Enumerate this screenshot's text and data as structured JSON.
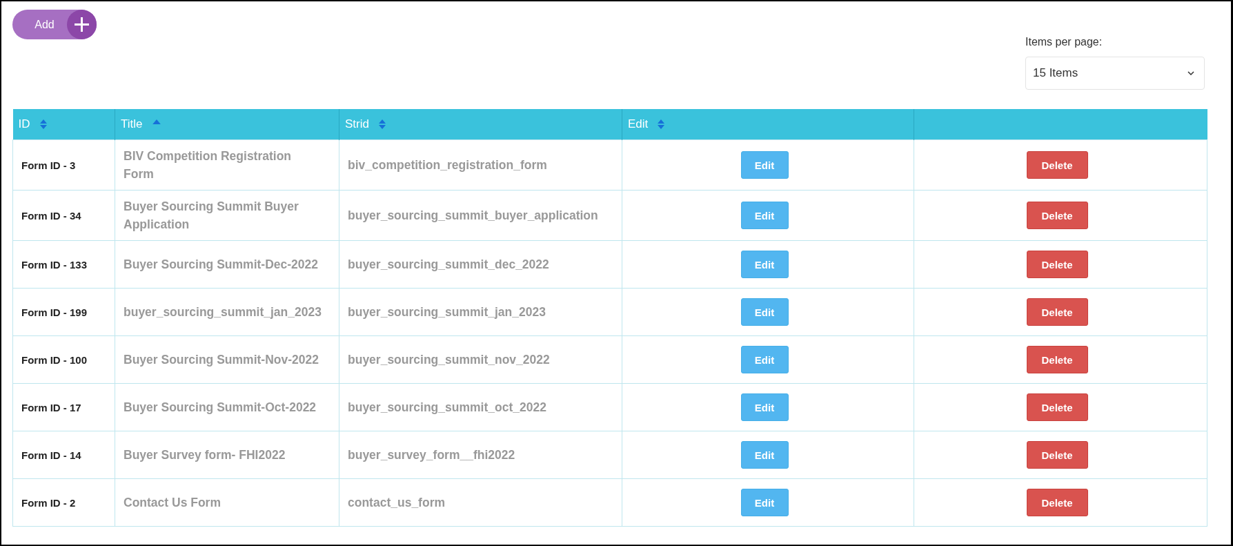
{
  "add_button": {
    "label": "Add"
  },
  "pagination": {
    "label": "Items per page:",
    "value": "15 Items"
  },
  "table": {
    "columns": [
      {
        "label": "ID",
        "sortable": true,
        "sorted": false
      },
      {
        "label": "Title",
        "sortable": true,
        "sorted": true
      },
      {
        "label": "Strid",
        "sortable": true,
        "sorted": false
      },
      {
        "label": "Edit",
        "sortable": true,
        "sorted": false
      },
      {
        "sortable": false
      }
    ],
    "rows": [
      {
        "id": "Form ID - 3",
        "title": "BIV Competition Registration Form",
        "strid": "biv_competition_registration_form",
        "edit": "Edit",
        "delete": "Delete"
      },
      {
        "id": "Form ID - 34",
        "title": "Buyer Sourcing Summit Buyer Application",
        "strid": "buyer_sourcing_summit_buyer_application",
        "edit": "Edit",
        "delete": "Delete"
      },
      {
        "id": "Form ID - 133",
        "title": "Buyer Sourcing Summit-Dec-2022",
        "strid": "buyer_sourcing_summit_dec_2022",
        "edit": "Edit",
        "delete": "Delete"
      },
      {
        "id": "Form ID - 199",
        "title": "buyer_sourcing_summit_jan_2023",
        "strid": "buyer_sourcing_summit_jan_2023",
        "edit": "Edit",
        "delete": "Delete"
      },
      {
        "id": "Form ID - 100",
        "title": "Buyer Sourcing Summit-Nov-2022",
        "strid": "buyer_sourcing_summit_nov_2022",
        "edit": "Edit",
        "delete": "Delete"
      },
      {
        "id": "Form ID - 17",
        "title": "Buyer Sourcing Summit-Oct-2022",
        "strid": "buyer_sourcing_summit_oct_2022",
        "edit": "Edit",
        "delete": "Delete"
      },
      {
        "id": "Form ID - 14",
        "title": "Buyer Survey form- FHI2022",
        "strid": "buyer_survey_form__fhi2022",
        "edit": "Edit",
        "delete": "Delete"
      },
      {
        "id": "Form ID - 2",
        "title": "Contact Us Form",
        "strid": "contact_us_form",
        "edit": "Edit",
        "delete": "Delete"
      }
    ]
  }
}
